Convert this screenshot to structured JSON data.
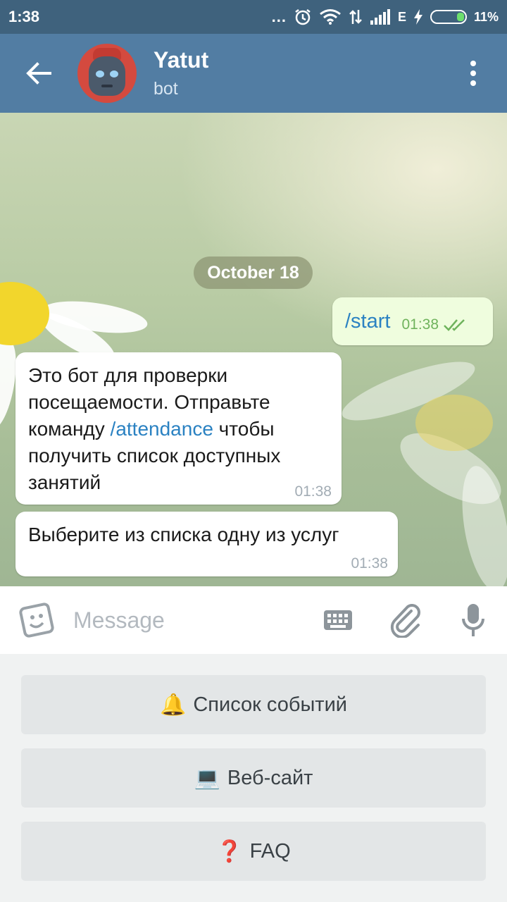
{
  "status_bar": {
    "time": "1:38",
    "dots": "...",
    "network": "E",
    "battery": "11%"
  },
  "header": {
    "title": "Yatut",
    "subtitle": "bot"
  },
  "chat": {
    "date_separator": "October 18",
    "outgoing": [
      {
        "text": "/start",
        "time": "01:38",
        "status": "read"
      }
    ],
    "incoming": [
      {
        "line1": "Это бот для проверки",
        "line2": "посещаемости. Отправьте",
        "line3_pre": "команду ",
        "line3_link": "/attendance",
        "line3_post": " чтобы",
        "line4": "получить список доступных",
        "line5": "занятий",
        "time": "01:38"
      },
      {
        "text": "Выберите из списка одну из услуг",
        "time": "01:38"
      }
    ]
  },
  "input": {
    "placeholder": "Message"
  },
  "keyboard": {
    "buttons": [
      {
        "emoji": "🔔",
        "label": "Список событий"
      },
      {
        "emoji": "💻",
        "label": "Веб-сайт"
      },
      {
        "emoji": "❓",
        "label": "FAQ"
      }
    ]
  },
  "colors": {
    "header": "#527da3",
    "status_bar": "#3f627d",
    "outgoing_bubble": "#effdde",
    "link": "#2b82c2",
    "read_check": "#6fb35c"
  }
}
